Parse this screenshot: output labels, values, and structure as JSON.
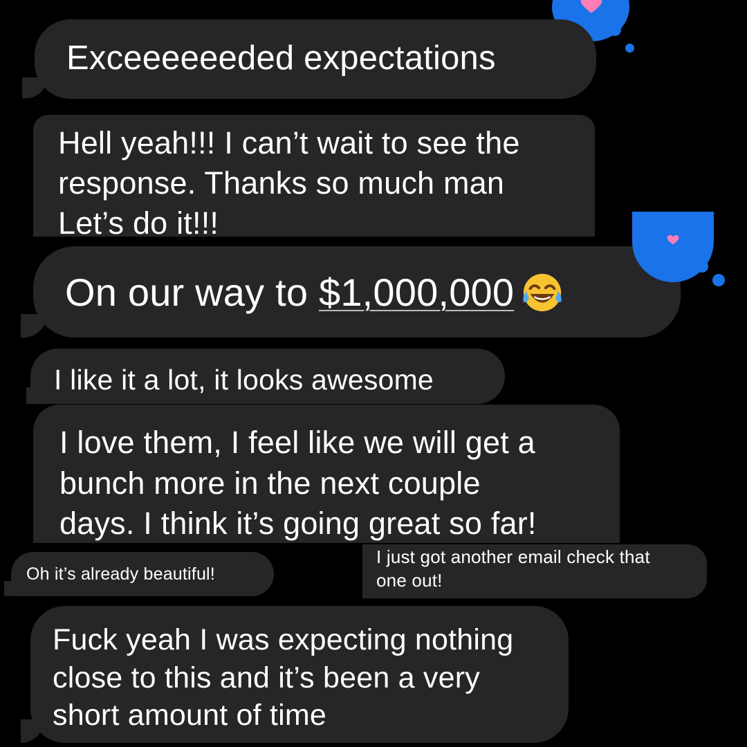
{
  "messages": [
    {
      "id": "m1",
      "text": "Exceeeeeeded expectations",
      "reaction": "heart"
    },
    {
      "id": "m2",
      "lines": [
        "Hell yeah!!! I can’t wait to see the",
        "response. Thanks so much man",
        "Let’s do it!!!"
      ]
    },
    {
      "id": "m3",
      "text_prefix": "On our way to ",
      "amount": "$1,000,000",
      "emoji": "face-with-tears-of-joy",
      "reaction": "heart"
    },
    {
      "id": "m4",
      "text": "I like it a lot, it looks awesome"
    },
    {
      "id": "m5",
      "lines": [
        "I love them, I feel like we will get a",
        "bunch more in the next couple",
        "days. I think it’s going great so far!"
      ]
    },
    {
      "id": "m6",
      "text": "Oh it’s already beautiful!"
    },
    {
      "id": "m7",
      "lines": [
        "I just got another email check that",
        "one out!"
      ]
    },
    {
      "id": "m8",
      "lines": [
        "Fuck yeah I was expecting nothing",
        "close to this and it’s been a very",
        "short amount of time"
      ]
    }
  ],
  "colors": {
    "background": "#000000",
    "bubble": "#262629",
    "text": "#ffffff",
    "reaction": "#1a73e8",
    "heart": "#ff7eb6"
  }
}
